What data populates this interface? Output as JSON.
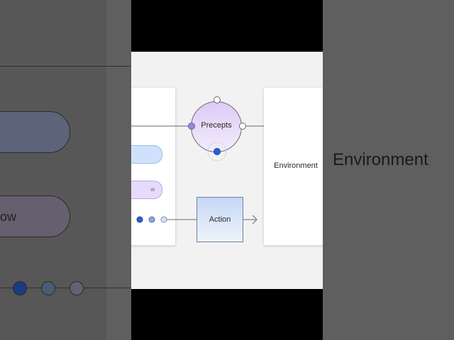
{
  "diagram": {
    "precepts_label": "Precepts",
    "action_label": "Action",
    "environment_label": "Environment",
    "pill_b_text": "w"
  },
  "background": {
    "environment_label": "Environment",
    "pill_text": "ow"
  },
  "colors": {
    "precepts_fill": "#dccbf7",
    "action_fill": "#c5d8f6",
    "dot_blue": "#2563d9",
    "dot_purple": "#9b85de",
    "frame_bg": "#f2f2f2",
    "letterbox": "#000000"
  }
}
